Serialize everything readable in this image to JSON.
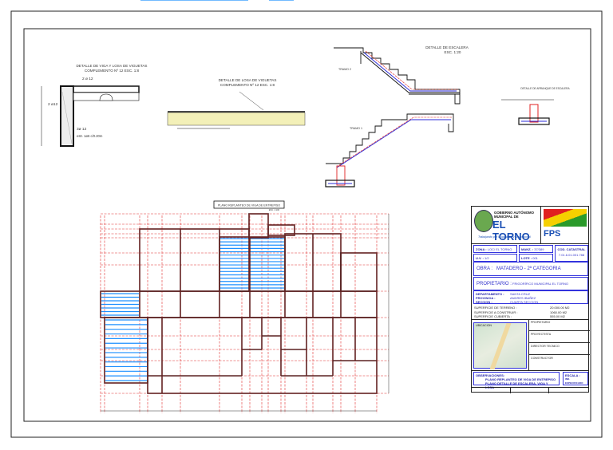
{
  "details": {
    "beam_title_1": "DETALLE DE  VIGA Y LOSA DE VIGUETAS",
    "beam_title_2": "COMPLEMENTO Nº 12   ESC. 1:8",
    "beam_bar_top": "2 ø 12",
    "beam_bar_side": "2 ø12",
    "beam_bar_bottom": "3ø 12",
    "beam_stirrup": "estr. 1ø6 c/0.20m",
    "slab_title_1": "DETALLE DE LOSA DE VIGUETAS",
    "slab_title_2": "COMPLEMENTO Nº 12   ESC. 1:8",
    "stair_title_1": "DETALLE DE ESCALERA",
    "stair_title_2": "ESC. 1:20",
    "tramo_2": "TRAMO 2",
    "tramo_1": "TRAMO 1",
    "footing_title": "DETALLE DE ARRANQUE DE ESCALERA"
  },
  "plan": {
    "title": "PLANO REPLANTEO DE VIGA DE ENTREPISO",
    "scale": "ESC. 1:100"
  },
  "title_block": {
    "logo_line1": "GOBIERNO AUTÓNOMO",
    "logo_line2": "MUNICIPAL DE",
    "logo_name": "EL TORNO",
    "logo_slogan": "Trabajando por la igualdad y futuro social",
    "fps_logo": "FPS",
    "zona_label": "ZONA :",
    "zona_value": "LOC/ EL TORNO",
    "uv_label": "U.V. :",
    "uv_value": "1/2",
    "manz_label": "MANZ. :",
    "manz_value": "37/389",
    "lote_label": "LOTE :",
    "lote_value": "001",
    "cod_label": "COD. CATASTRAL",
    "cod_value": "7.01.6.01.001.788",
    "obra_label": "OBRA :",
    "obra_value": "MATADERO - 2ª CATEGORIA",
    "prop_label": "PROPIETARIO :",
    "prop_value": "FRIGORÍFICO MUNICIPAL EL TORNO",
    "depto_label": "DEPARTAMENTO :",
    "depto_value": "SANTA CRUZ",
    "prov_label": "PROVINCIA :",
    "prov_value": "ANDRES IBAÑEZ",
    "secc_label": "SECCION :",
    "secc_value": "CUARTA SECCION",
    "sup_terreno_label": "SUPERFICIE DE TERRENO :",
    "sup_terreno_value": "20.000.00 M2",
    "sup_construir_label": "SUPERFICIE A CONSTRUIR :",
    "sup_construir_value": "1060.00 M2",
    "sup_cubierta_label": "SUPERFICIE CUBIERTA :",
    "sup_cubierta_value": "555.00 M2",
    "ubicacion_label": "UBICACION",
    "propietario_sign": "PROPIETARIO",
    "proyectista_sign": "PROYECTISTA",
    "director_sign": "DIRECTOR TECNICO",
    "constructor_sign": "CONSTRUCTOR",
    "obs_label": "OBSERVACIONES:",
    "obs_line1": "PLANO REPLANTEO DE VIGA DE ENTREPISO",
    "obs_line2": "PLANO DETALLE DE ESCALERA, VIGA Y LOSA",
    "escala_label": "ESCALA :",
    "escala_value": "IND. ESPECIFICADO"
  },
  "colors": {
    "rebar_red": "#e02020",
    "rebar_blue": "#2a2ad8",
    "slab_blue": "#1e90ff",
    "grid_red": "#e03030",
    "slab_fill": "#f3f0b8"
  }
}
